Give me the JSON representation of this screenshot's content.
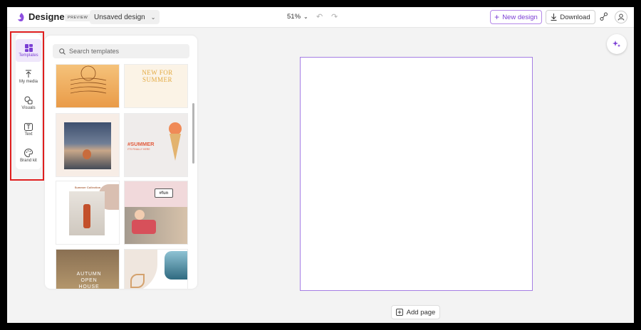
{
  "app": {
    "name": "Designer",
    "badge": "PREVIEW",
    "design_name": "Unsaved design"
  },
  "toolbar": {
    "zoom": "51%",
    "new_design_label": "New design",
    "download_label": "Download"
  },
  "nav": {
    "items": [
      {
        "label": "Templates",
        "icon": "templates-icon",
        "active": true
      },
      {
        "label": "My media",
        "icon": "upload-icon"
      },
      {
        "label": "Visuals",
        "icon": "shapes-icon"
      },
      {
        "label": "Text",
        "icon": "text-icon"
      },
      {
        "label": "Brand kit",
        "icon": "palette-icon"
      }
    ]
  },
  "panel": {
    "search_placeholder": "Search templates",
    "templates": [
      {
        "text": ""
      },
      {
        "text": "NEW FOR SUMMER"
      },
      {
        "text": ""
      },
      {
        "text": "#SUMMER",
        "subtext": "IT'S FINALLY HERE"
      },
      {
        "text": "Summer Collection"
      },
      {
        "text": "#fun"
      },
      {
        "text": "AUTUMN OPEN HOUSE"
      },
      {
        "text": ""
      }
    ]
  },
  "canvas": {
    "add_page_label": "Add page"
  },
  "colors": {
    "accent": "#7b3fd4",
    "highlight": "#e01f1f"
  }
}
